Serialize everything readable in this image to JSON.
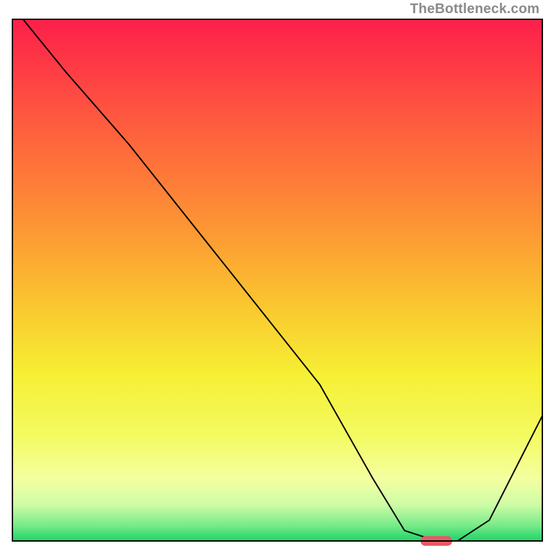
{
  "watermark": "TheBottleneck.com",
  "chart_data": {
    "type": "line",
    "title": "",
    "xlabel": "",
    "ylabel": "",
    "xlim": [
      0,
      100
    ],
    "ylim": [
      0,
      100
    ],
    "grid": false,
    "legend": false,
    "background": {
      "type": "vertical-gradient",
      "stops": [
        {
          "pct": 0,
          "color": "#fd1f4a"
        },
        {
          "pct": 20,
          "color": "#fe5c3e"
        },
        {
          "pct": 40,
          "color": "#fd9634"
        },
        {
          "pct": 55,
          "color": "#fac72f"
        },
        {
          "pct": 68,
          "color": "#f6ef34"
        },
        {
          "pct": 80,
          "color": "#f3fb62"
        },
        {
          "pct": 88,
          "color": "#f4ffa0"
        },
        {
          "pct": 93,
          "color": "#cffca6"
        },
        {
          "pct": 97,
          "color": "#78eb89"
        },
        {
          "pct": 100,
          "color": "#1fd368"
        }
      ]
    },
    "series": [
      {
        "name": "bottleneck-curve",
        "color": "#000000",
        "x": [
          2,
          10,
          22,
          40,
          58,
          68,
          74,
          80,
          84,
          90,
          100
        ],
        "y": [
          100,
          90,
          76,
          53,
          30,
          12,
          2,
          0,
          0,
          4,
          24
        ]
      }
    ],
    "markers": [
      {
        "name": "result-marker",
        "shape": "rounded-bar",
        "color": "#e65a63",
        "x_center": 80,
        "width_pct": 6,
        "y": 0
      }
    ],
    "frame": {
      "stroke": "#000000",
      "width": 2
    }
  }
}
